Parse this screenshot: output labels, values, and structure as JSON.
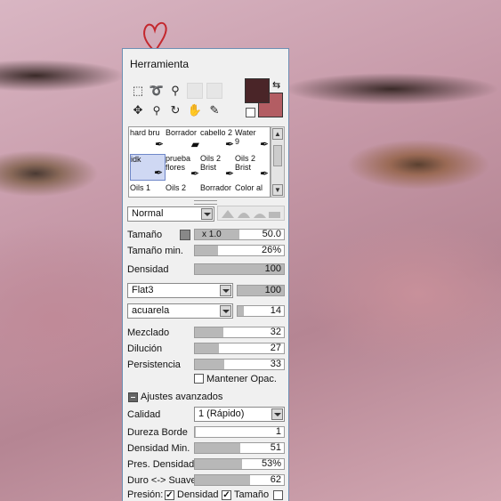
{
  "panel": {
    "title": "Herramienta",
    "colors": {
      "main": "#4a2528",
      "secondary": "#b35d63"
    }
  },
  "tools": [
    {
      "name": "select-rect-icon",
      "glyph": "⬚"
    },
    {
      "name": "lasso-icon",
      "glyph": "➰"
    },
    {
      "name": "magic-wand-icon",
      "glyph": "⚲"
    },
    {
      "name": "move-icon",
      "glyph": "✥"
    },
    {
      "name": "zoom-icon",
      "glyph": "🔍"
    },
    {
      "name": "rotate-icon",
      "glyph": "↻"
    },
    {
      "name": "hand-icon",
      "glyph": "✋"
    },
    {
      "name": "eyedropper-icon",
      "glyph": "✎"
    }
  ],
  "brushes": {
    "row1": [
      "hard bru",
      "Borrador",
      "cabello 2",
      "Water\n9"
    ],
    "row2": [
      "idk",
      "prueba\nflores",
      "Oils 2\nBrist",
      "Oils 2\nBrist"
    ],
    "row3": [
      "Oils 1",
      "Oils 2",
      "Borrador",
      "Color al"
    ]
  },
  "blend": {
    "mode": "Normal"
  },
  "params": {
    "size_label": "Tamaño",
    "size_multiplier": "x 1.0",
    "size_value": "50.0",
    "min_size_label": "Tamaño min.",
    "min_size_value": "26%",
    "density_label": "Densidad",
    "density_value": "100",
    "texture_name": "Flat3",
    "texture_value": "100",
    "paper_name": "acuarela",
    "paper_value": "14",
    "mixing_label": "Mezclado",
    "mixing_value": "32",
    "dilution_label": "Dilución",
    "dilution_value": "27",
    "persistence_label": "Persistencia",
    "persistence_value": "33",
    "keep_opacity_label": "Mantener Opac."
  },
  "advanced": {
    "header": "Ajustes avanzados",
    "quality_label": "Calidad",
    "quality_value": "1 (Rápido)",
    "hardness_label": "Dureza Borde",
    "hardness_value": "1",
    "min_density_label": "Densidad Min.",
    "min_density_value": "51",
    "pressure_density_label": "Pres. Densidad",
    "pressure_density_value": "53%",
    "hard_soft_label": "Duro <-> Suave",
    "hard_soft_value": "62",
    "pressure_label": "Presión:",
    "pressure_density_chk": "Densidad",
    "pressure_size_chk": "Tamaño"
  },
  "levels": {
    "min_size": 0.26,
    "density": 1.0,
    "texture": 1.0,
    "paper": 0.14,
    "mixing": 0.32,
    "dilution": 0.27,
    "persistence": 0.33,
    "hardness": 0.01,
    "min_density": 0.51,
    "pressure_density": 0.53,
    "hard_soft": 0.62
  }
}
